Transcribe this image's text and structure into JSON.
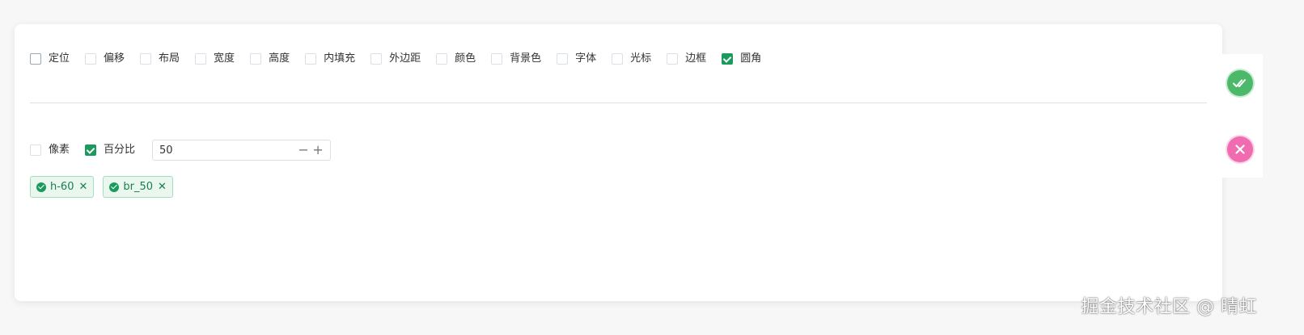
{
  "properties": [
    {
      "label": "定位",
      "checked": false
    },
    {
      "label": "偏移",
      "checked": false
    },
    {
      "label": "布局",
      "checked": false
    },
    {
      "label": "宽度",
      "checked": false
    },
    {
      "label": "高度",
      "checked": false
    },
    {
      "label": "内填充",
      "checked": false
    },
    {
      "label": "外边距",
      "checked": false
    },
    {
      "label": "颜色",
      "checked": false
    },
    {
      "label": "背景色",
      "checked": false
    },
    {
      "label": "字体",
      "checked": false
    },
    {
      "label": "光标",
      "checked": false
    },
    {
      "label": "边框",
      "checked": false
    },
    {
      "label": "圆角",
      "checked": true
    }
  ],
  "units": {
    "pixel": {
      "label": "像素",
      "checked": false
    },
    "percent": {
      "label": "百分比",
      "checked": true
    }
  },
  "stepper": {
    "value": "50",
    "minus": "−",
    "plus": "+"
  },
  "tags": [
    {
      "label": "h-60",
      "close": "✕"
    },
    {
      "label": "br_50",
      "close": "✕"
    }
  ],
  "actions": {
    "confirm_icon": "double-check-icon",
    "cancel_icon": "close-icon"
  },
  "watermark": "掘金技术社区 @ 晴虹",
  "colors": {
    "accent": "#1a9a5c",
    "confirm": "#4cb86a",
    "cancel": "#f06bb0"
  }
}
